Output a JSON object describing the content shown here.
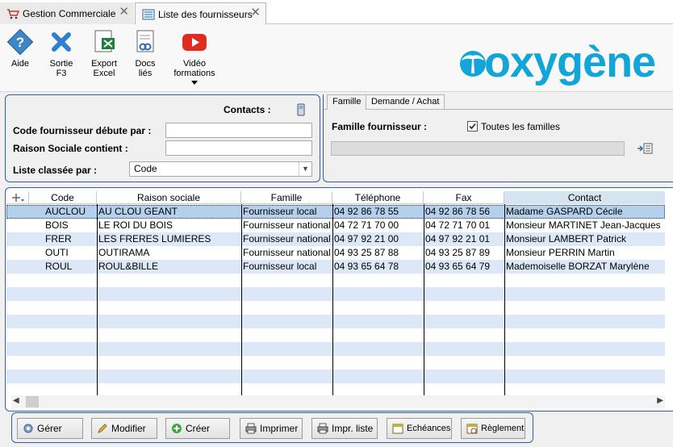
{
  "tabs": [
    {
      "label": "Gestion Commerciale",
      "close": "✕"
    },
    {
      "label": "Liste des fournisseurs",
      "close": "✕"
    }
  ],
  "toolbar": {
    "aide": "Aide",
    "sortie_line1": "Sortie",
    "sortie_line2": "F3",
    "export_line1": "Export",
    "export_line2": "Excel",
    "docs_line1": "Docs",
    "docs_line2": "liés",
    "video_line1": "Vidéo",
    "video_line2": "formations"
  },
  "logo": "oxygène",
  "search": {
    "contacts_label": "Contacts :",
    "code_label": "Code fournisseur débute par :",
    "code_value": "",
    "raison_label": "Raison Sociale contient :",
    "raison_value": "",
    "sort_label": "Liste classée par :",
    "sort_value": "Code"
  },
  "right_panel": {
    "tab_famille": "Famille",
    "tab_demande": "Demande / Achat",
    "famille_label": "Famille fournisseur :",
    "toutes_label": "Toutes les familles",
    "toutes_checked": true
  },
  "grid": {
    "columns": [
      "Code",
      "Raison sociale",
      "Famille",
      "Téléphone",
      "Fax",
      "Contact"
    ],
    "rows": [
      [
        "AUCLOU",
        "AU CLOU GEANT",
        "Fournisseur local",
        "04 92 86 78 55",
        "04 92 86 78 56",
        "Madame GASPARD Cécile"
      ],
      [
        "BOIS",
        "LE ROI DU BOIS",
        "Fournisseur national",
        "04 72 71 70 00",
        "04 72 71 70 01",
        "Monsieur MARTINET Jean-Jacques"
      ],
      [
        "FRER",
        "LES FRERES LUMIERES",
        "Fournisseur national",
        "04 97 92 21 00",
        "04 97 92 21 01",
        "Monsieur LAMBERT Patrick"
      ],
      [
        "OUTI",
        "OUTIRAMA",
        "Fournisseur national",
        "04 93 25 87 88",
        "04 93 25 87 89",
        "Monsieur PERRIN Martin"
      ],
      [
        "ROUL",
        "ROUL&BILLE",
        "Fournisseur local",
        "04 93 65 64 78",
        "04 93 65 64 79",
        "Mademoiselle BORZAT Marylène"
      ]
    ]
  },
  "buttons": {
    "gerer": "Gérer",
    "modifier": "Modifier",
    "creer": "Créer",
    "imprimer": "Imprimer",
    "impr_liste": "Impr. liste",
    "echeances": "Echéances",
    "reglement": "Règlement"
  },
  "colors": {
    "accent_border": "#2d5ea8",
    "logo": "#12a5d8",
    "selected_row": "#b5d0ec",
    "alt_row": "#dce8f7"
  }
}
